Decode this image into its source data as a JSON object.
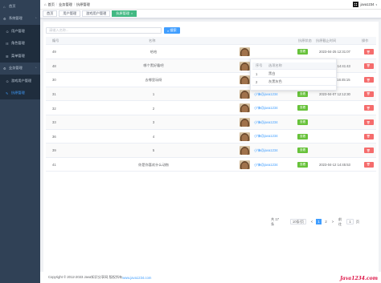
{
  "sidebar": {
    "items": [
      {
        "label": "首页",
        "level": 0,
        "active": false,
        "arrow": ""
      },
      {
        "label": "系统管理",
        "level": 0,
        "active": false,
        "arrow": "⌃"
      },
      {
        "label": "用户管理",
        "level": 1,
        "active": false,
        "arrow": ""
      },
      {
        "label": "角色管理",
        "level": 1,
        "active": false,
        "arrow": ""
      },
      {
        "label": "菜单管理",
        "level": 1,
        "active": false,
        "arrow": ""
      },
      {
        "label": "业务管理",
        "level": 0,
        "active": false,
        "arrow": "⌃"
      },
      {
        "label": "游戏用户管理",
        "level": 1,
        "active": false,
        "arrow": ""
      },
      {
        "label": "抗原管理",
        "level": 1,
        "active": true,
        "arrow": ""
      }
    ]
  },
  "header": {
    "breadcrumb": [
      "首页",
      "业务管理",
      "抗原管理"
    ],
    "username": "java1234"
  },
  "tabs": [
    {
      "label": "首页",
      "active": false,
      "closable": false
    },
    {
      "label": "用户管理",
      "active": false,
      "closable": false
    },
    {
      "label": "游戏用户管理",
      "active": false,
      "closable": false
    },
    {
      "label": "抗原管理",
      "active": true,
      "closable": true
    }
  ],
  "toolbar": {
    "search_placeholder": "请输入名称...",
    "search_button": "搜索"
  },
  "table": {
    "columns": [
      "编号",
      "名称",
      "",
      "",
      "抗原状态",
      "抗原截止时间",
      "操作"
    ],
    "rows": [
      {
        "id": "49",
        "name": "哈哈",
        "uploader": "",
        "status": "查看",
        "time": "2023-04-25 12:31:07"
      },
      {
        "id": "48",
        "name": "哪个黑好看吧",
        "uploader": "",
        "status": "查看",
        "time": "2023-04-05 14:41:43"
      },
      {
        "id": "30",
        "name": "去哪里玩呀",
        "uploader": "小锋@java1234",
        "status": "查看",
        "time": "2023-04-11 16:45:15"
      },
      {
        "id": "31",
        "name": "1",
        "uploader": "小锋@java1234",
        "status": "查看",
        "time": "2023-04-07 12:12:30"
      },
      {
        "id": "32",
        "name": "2",
        "uploader": "小锋@java1234",
        "status": "查看",
        "time": ""
      },
      {
        "id": "33",
        "name": "3",
        "uploader": "小锋@java1234",
        "status": "查看",
        "time": ""
      },
      {
        "id": "36",
        "name": "4",
        "uploader": "小锋@java1234",
        "status": "查看",
        "time": ""
      },
      {
        "id": "39",
        "name": "5",
        "uploader": "小锋@java1234",
        "status": "查看",
        "time": ""
      },
      {
        "id": "41",
        "name": "你是你喜欢什么动物",
        "uploader": "小锋@java1234",
        "status": "查看",
        "time": "2023-04-12 14:45:53"
      }
    ]
  },
  "popover": {
    "columns": [
      "序号",
      "选项名称"
    ],
    "rows": [
      {
        "index": "1",
        "name": "黑白"
      },
      {
        "index": "2",
        "name": "灰黑灰色"
      }
    ]
  },
  "pager": {
    "total": "共 17 条",
    "page_size": "10条/页",
    "prev": "<",
    "pages": [
      "1",
      "2"
    ],
    "next": ">",
    "goto_label": "前往",
    "goto_value": "1",
    "goto_unit": "页"
  },
  "footer": {
    "text": "Copyright © 2012-2023 Java知识分享网 版权所有",
    "link": "www.java1234.com",
    "watermark": "Java1234.com"
  }
}
